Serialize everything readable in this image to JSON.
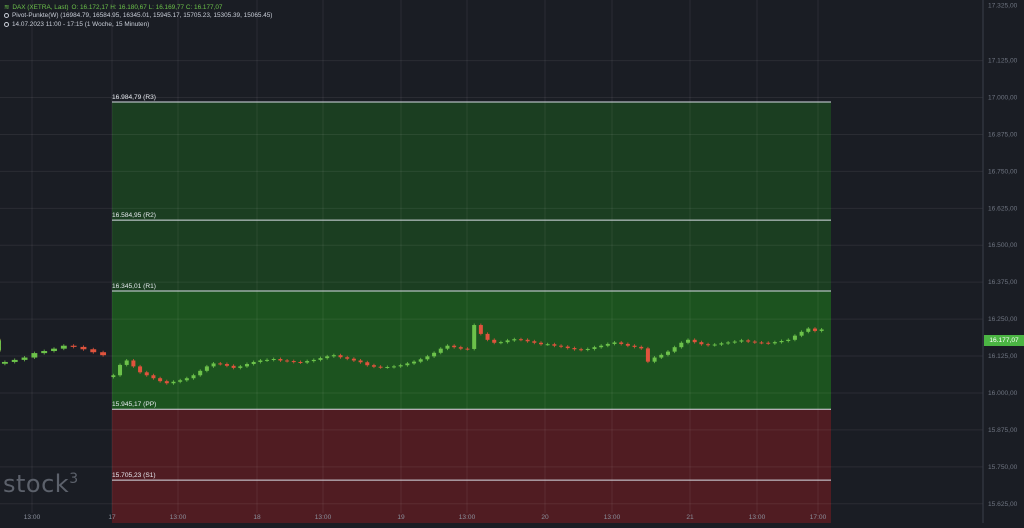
{
  "header": {
    "symbol_icon": "chart-lines-icon",
    "symbol": "DAX (XETRA, Last)",
    "ohlc": "O: 16.172,17   H: 16.180,67   L: 16.169,77   C: 16.177,07",
    "indicator_icon": "indicator-dot-icon",
    "indicator": "Pivot-Punkte(W)  (16984.79,   16584.95,   16345.01,   15945.17,   15705.23,   15305.39,   15065.45)",
    "period_icon": "clock-icon",
    "period": "14.07.2023 11:00 - 17:15   (1 Woche, 15 Minuten)"
  },
  "logo": {
    "text": "stock",
    "sup": "3"
  },
  "last_price_label": "16.177,07",
  "colors": {
    "background": "#1a1d24",
    "up": "#6cc24a",
    "down": "#e0533d",
    "resistance_fill": "#1d5a1f",
    "support_fill": "#5a1c22",
    "price_label": "#4bb543"
  },
  "chart_data": {
    "type": "candlestick",
    "ylim": [
      15560,
      17330
    ],
    "y_ticks": [
      "17.125,00",
      "17.000,00",
      "16.875,00",
      "16.750,00",
      "16.625,00",
      "16.500,00",
      "16.375,00",
      "16.250,00",
      "16.125,00",
      "16.000,00",
      "15.875,00",
      "15.750,00",
      "15.625,00"
    ],
    "y_tick_values": [
      17125,
      17000,
      16875,
      16750,
      16625,
      16500,
      16375,
      16250,
      16125,
      16000,
      15875,
      15750,
      15625
    ],
    "top_tick_label": "17.325,00",
    "x_ticks": [
      "13:00",
      "17",
      "13:00",
      "18",
      "13:00",
      "19",
      "13:00",
      "20",
      "13:00",
      "21",
      "13:00",
      "17:00"
    ],
    "pivots": [
      {
        "label": "16.984,79 (R3)",
        "value": 16984.79
      },
      {
        "label": "16.584,95 (R2)",
        "value": 16584.95
      },
      {
        "label": "16.345,01 (R1)",
        "value": 16345.01
      },
      {
        "label": "15.945,17 (PP)",
        "value": 15945.17
      },
      {
        "label": "15.705,23 (S1)",
        "value": 15705.23
      }
    ],
    "last_price": 16177.07,
    "close_segments": [
      [
        16105,
        16112,
        16120,
        16135,
        16142,
        16150,
        16160,
        16156,
        16148,
        16138,
        16128
      ],
      [
        16060,
        16095,
        16110,
        16090,
        16070,
        16060,
        16050,
        16040,
        16033,
        16038,
        16043,
        16050,
        16060,
        16075,
        16090,
        16100,
        16098,
        16092,
        16085,
        16090,
        16098,
        16105,
        16110,
        16112,
        16115,
        16110,
        16108,
        16105,
        16103,
        16108,
        16112,
        16118,
        16124,
        16128,
        16121,
        16116,
        16110,
        16104,
        16094,
        16089,
        16087,
        16088,
        16090,
        16094,
        16100,
        16106,
        16114,
        16124,
        16136,
        16150,
        16160,
        16155,
        16150,
        16149,
        16230,
        16200,
        16180,
        16170,
        16172,
        16178,
        16182,
        16180,
        16175,
        16170,
        16165,
        16165,
        16160,
        16157,
        16152,
        16148,
        16146,
        16149,
        16155,
        16160,
        16166,
        16171,
        16166,
        16160,
        16156,
        16151,
        16106,
        16120,
        16129,
        16140,
        16155,
        16170,
        16180,
        16172,
        16165,
        16162,
        16164,
        16168,
        16171,
        16174,
        16178,
        16174,
        16171,
        16170,
        16168,
        16172,
        16176,
        16180,
        16194,
        16207,
        16218,
        16210,
        16215
      ],
      [
        16156,
        16150,
        16146,
        16150,
        16156,
        16161,
        16158,
        16154,
        16150,
        16153,
        16158,
        16155,
        16150,
        16145,
        16148,
        16156,
        16168,
        16178,
        16170,
        16163,
        16175,
        16177
      ]
    ]
  }
}
